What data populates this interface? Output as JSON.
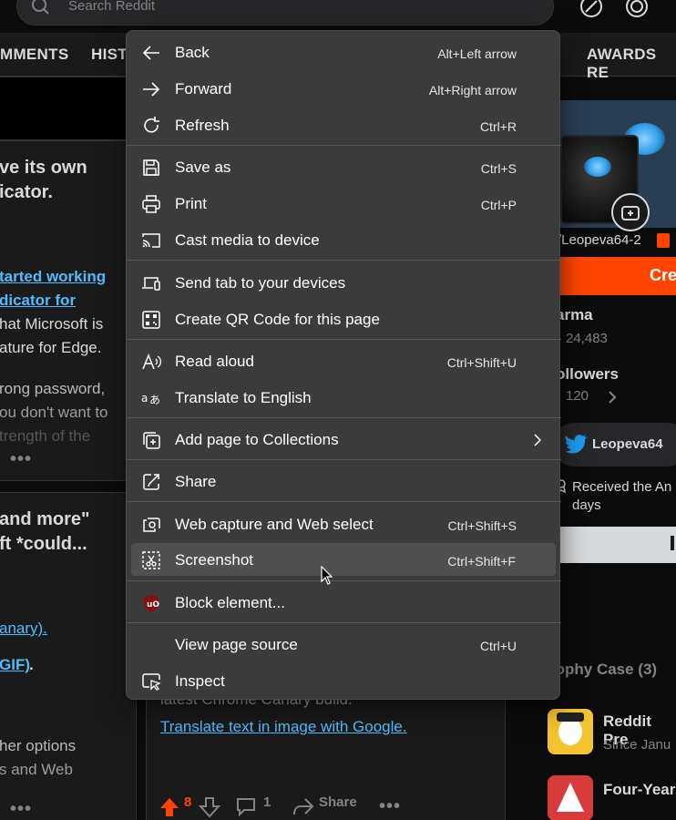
{
  "search": {
    "placeholder": "Search Reddit"
  },
  "profile_tabs": [
    "MMENTS",
    "HIST",
    "AWARDS RE"
  ],
  "posts": {
    "p1": {
      "title_lines": [
        "ve its own",
        "icator."
      ],
      "link_lines": [
        "tarted working",
        "dicator for"
      ],
      "body_lines": [
        "hat Microsoft is",
        "ature for Edge."
      ],
      "more_lines": [
        "rong password,",
        "ou don't want to",
        "trength of the"
      ]
    },
    "p2": {
      "title_lines": [
        "and more\"",
        "ft *could..."
      ],
      "link1": "anary).",
      "link2": "GIF)",
      "link2_suffix": ".",
      "body_lines": [
        "her options",
        "s and Web"
      ]
    },
    "p3": {
      "partial_line": "latest Chrome Canary build.",
      "link": "Translate text in image with Google.",
      "vote_count": "8",
      "comment_count": "1",
      "share": "Share"
    },
    "dots": "•••"
  },
  "sidebar": {
    "username": "/Leopeva64-2",
    "create": "Cre",
    "karma_label": "arma",
    "karma_value": "24,483",
    "followers_label": "ollowers",
    "followers_value": "120",
    "twitter_handle": "Leopeva64",
    "award_text_lines": [
      "Received the An",
      "days"
    ],
    "trophy_title": "rophy Case (3)",
    "trophies": [
      {
        "name": "Reddit Pre",
        "sub": "Since Janu"
      },
      {
        "name": "Four-Year",
        "sub": ""
      }
    ]
  },
  "context_menu": {
    "items": [
      {
        "label": "Back",
        "shortcut": "Alt+Left arrow",
        "icon": "back-arrow-icon"
      },
      {
        "label": "Forward",
        "shortcut": "Alt+Right arrow",
        "icon": "forward-arrow-icon"
      },
      {
        "label": "Refresh",
        "shortcut": "Ctrl+R",
        "icon": "refresh-icon"
      },
      {
        "label": "Save as",
        "shortcut": "Ctrl+S",
        "icon": "save-icon"
      },
      {
        "label": "Print",
        "shortcut": "Ctrl+P",
        "icon": "printer-icon"
      },
      {
        "label": "Cast media to device",
        "shortcut": "",
        "icon": "cast-icon"
      },
      {
        "label": "Send tab to your devices",
        "shortcut": "",
        "icon": "devices-icon"
      },
      {
        "label": "Create QR Code for this page",
        "shortcut": "",
        "icon": "qr-code-icon"
      },
      {
        "label": "Read aloud",
        "shortcut": "Ctrl+Shift+U",
        "icon": "read-aloud-icon"
      },
      {
        "label": "Translate to English",
        "shortcut": "",
        "icon": "translate-icon"
      },
      {
        "label": "Add page to Collections",
        "shortcut": "",
        "icon": "collections-icon"
      },
      {
        "label": "Share",
        "shortcut": "",
        "icon": "share-icon"
      },
      {
        "label": "Web capture and Web select",
        "shortcut": "Ctrl+Shift+S",
        "icon": "web-capture-icon"
      },
      {
        "label": "Screenshot",
        "shortcut": "Ctrl+Shift+F",
        "icon": "screenshot-icon",
        "highlighted": true
      },
      {
        "label": "Block element...",
        "shortcut": "",
        "icon": "ublock-shield-icon"
      },
      {
        "label": "View page source",
        "shortcut": "Ctrl+U",
        "icon": ""
      },
      {
        "label": "Inspect",
        "shortcut": "",
        "icon": "inspect-icon"
      }
    ]
  },
  "colors": {
    "menu_bg": "#3b3b3b",
    "menu_highlight": "#505050",
    "reddit_orange": "#ff4500",
    "link_blue": "#4fbcff",
    "page_bg": "#0b0b0c",
    "card_bg": "#1a1a1b"
  }
}
